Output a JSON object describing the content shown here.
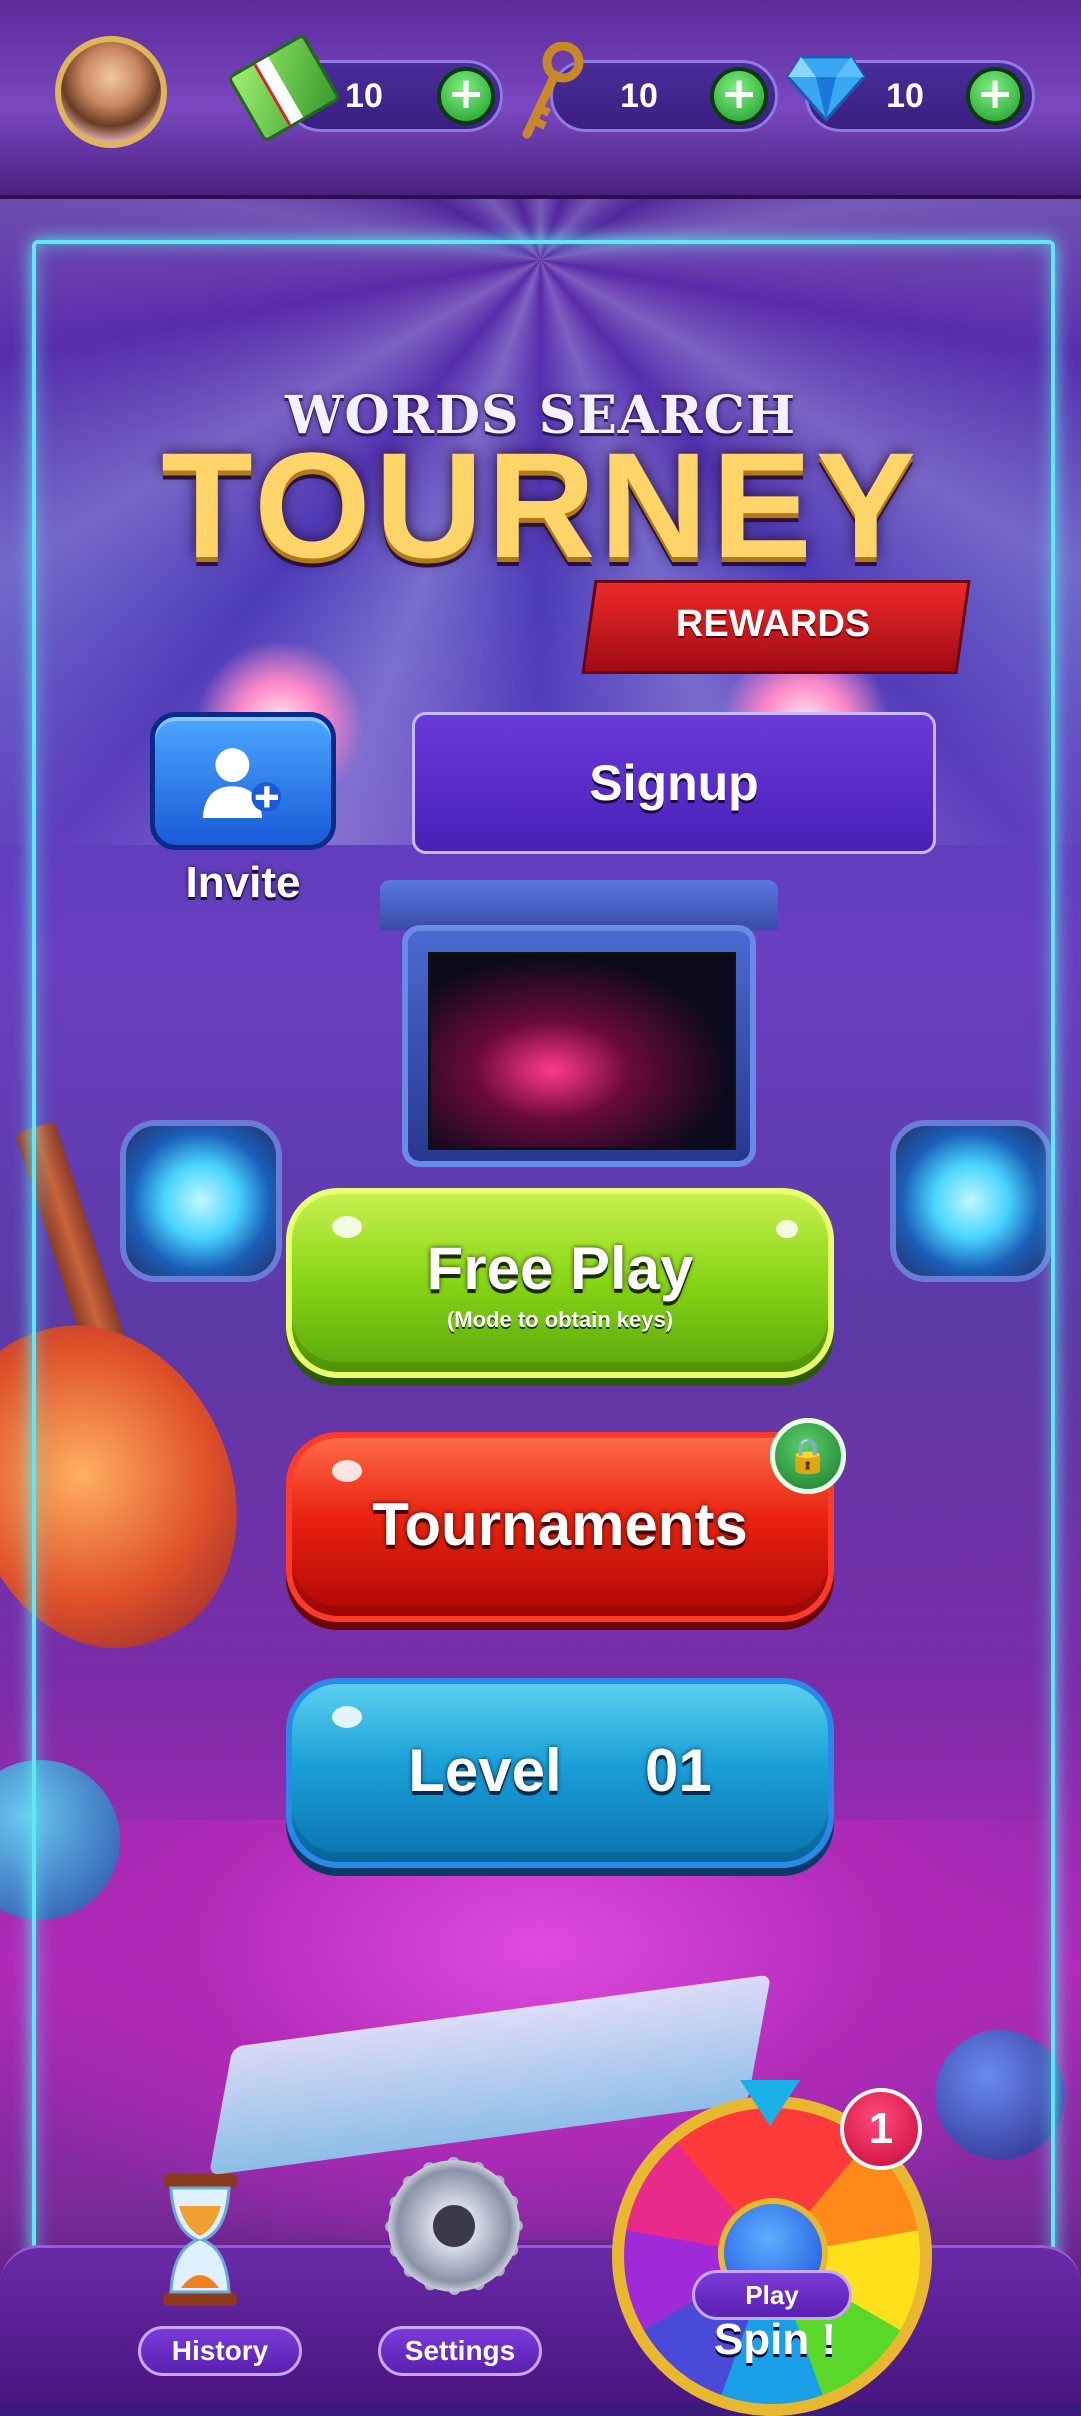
{
  "header": {
    "currencies": [
      {
        "icon": "cash-icon",
        "value": "10",
        "add": "+"
      },
      {
        "icon": "key-icon",
        "value": "10",
        "add": "+"
      },
      {
        "icon": "diamond-icon",
        "value": "10",
        "add": "+"
      }
    ]
  },
  "title": {
    "subtitle": "WORDS SEARCH",
    "main": "TOURNEY",
    "ribbon": "REWARDS"
  },
  "invite": {
    "label": "Invite",
    "icon": "add-user-icon"
  },
  "signup": {
    "label": "Signup"
  },
  "buttons": {
    "free_play": {
      "label": "Free Play",
      "sublabel": "(Mode to obtain keys)"
    },
    "tournaments": {
      "label": "Tournaments",
      "lock_icon": "lock-icon"
    },
    "level": {
      "label": "Level",
      "number": "01"
    }
  },
  "bottom": {
    "history": "History",
    "settings": "Settings",
    "spin": {
      "play": "Play",
      "label": "Spin !",
      "badge": "1"
    }
  },
  "colors": {
    "accent_green": "#8cd818",
    "accent_red": "#e8220e",
    "accent_blue": "#1aa0d8",
    "frame_glow": "#5ee8f0",
    "bar_purple": "#6a2aa8"
  }
}
